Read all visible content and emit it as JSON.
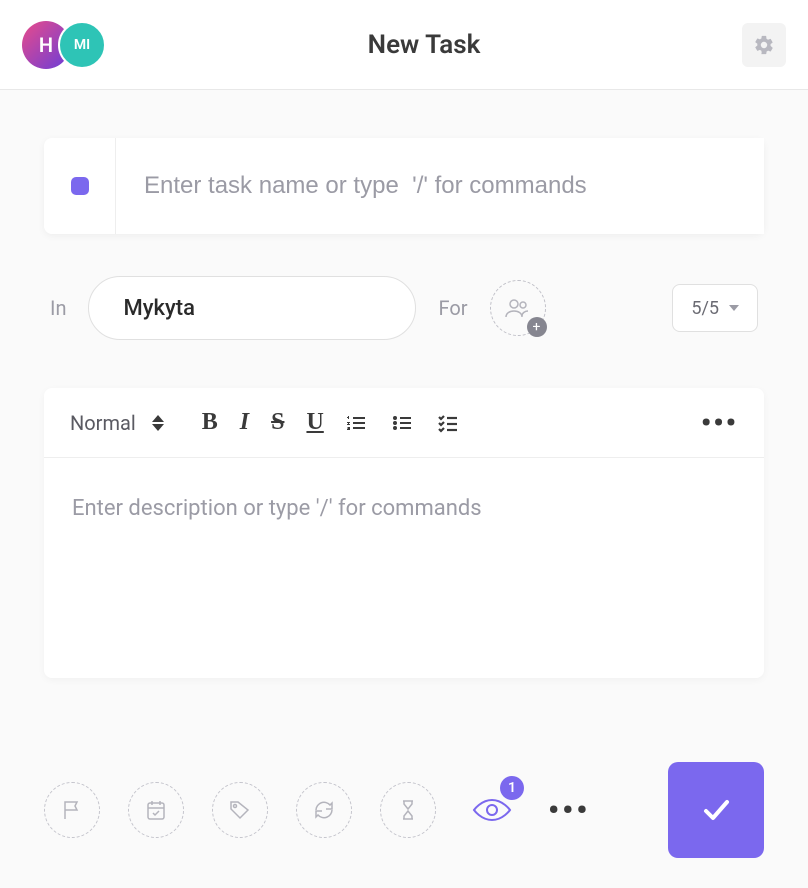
{
  "header": {
    "title": "New Task",
    "avatar1_label": "H",
    "avatar2_label": "MI"
  },
  "task_name": {
    "placeholder": "Enter task name or type  '/' for commands",
    "value": ""
  },
  "meta": {
    "in_label": "In",
    "in_value": "Mykyta",
    "for_label": "For",
    "priority_value": "5/5"
  },
  "editor": {
    "style_label": "Normal",
    "placeholder": "Enter description or type '/' for commands"
  },
  "footer": {
    "watch_count": "1"
  }
}
